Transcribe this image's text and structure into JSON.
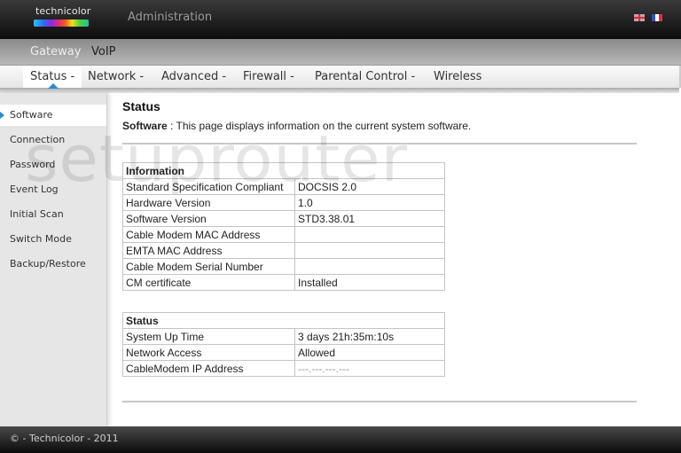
{
  "header": {
    "logo_text": "technicolor",
    "title": "Administration",
    "languages": [
      {
        "name": "English",
        "icon": "uk-flag-icon"
      },
      {
        "name": "Français",
        "icon": "france-flag-icon"
      }
    ]
  },
  "top_nav": {
    "items": [
      {
        "label": "Gateway",
        "active": true
      },
      {
        "label": "VoIP",
        "active": false
      }
    ]
  },
  "sub_nav": {
    "items": [
      {
        "label": "Status -",
        "active": true
      },
      {
        "label": "Network -"
      },
      {
        "label": "Advanced -"
      },
      {
        "label": "Firewall -"
      },
      {
        "label": "Parental Control -"
      },
      {
        "label": "Wireless"
      }
    ]
  },
  "sidebar": {
    "items": [
      {
        "label": "Software",
        "active": true
      },
      {
        "label": "Connection"
      },
      {
        "label": "Password"
      },
      {
        "label": "Event Log"
      },
      {
        "label": "Initial Scan"
      },
      {
        "label": "Switch Mode"
      },
      {
        "label": "Backup/Restore"
      }
    ]
  },
  "watermark": "setuprouter",
  "main": {
    "title": "Status",
    "desc_label": "Software",
    "desc_sep": " : ",
    "desc_text": "This page displays information on the current system software.",
    "info_table": {
      "header": "Information",
      "rows": [
        {
          "key": "Standard Specification Compliant",
          "value": "DOCSIS 2.0"
        },
        {
          "key": "Hardware Version",
          "value": "1.0"
        },
        {
          "key": "Software Version",
          "value": "STD3.38.01"
        },
        {
          "key": "Cable Modem MAC Address",
          "value": ""
        },
        {
          "key": "EMTA MAC Address",
          "value": ""
        },
        {
          "key": "Cable Modem Serial Number",
          "value": ""
        },
        {
          "key": "CM certificate",
          "value": "Installed"
        }
      ]
    },
    "status_table": {
      "header": "Status",
      "rows": [
        {
          "key": "System Up Time",
          "value": "3 days 21h:35m:10s"
        },
        {
          "key": "Network Access",
          "value": "Allowed"
        },
        {
          "key": "CableModem IP Address",
          "value": "---.---.---.---"
        }
      ]
    }
  },
  "footer": {
    "text": "© - Technicolor - 2011"
  },
  "colors": {
    "accent": "#2a8ad0",
    "header_bg": "#0c0c0c"
  }
}
